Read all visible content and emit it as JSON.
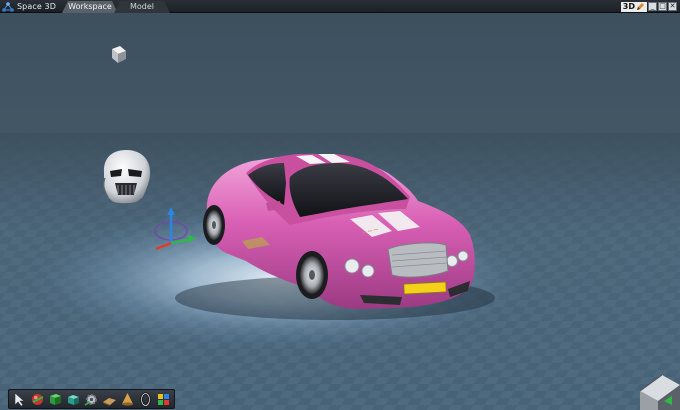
{
  "app": {
    "title": "Space 3D",
    "logo_icon": "molecule-icon"
  },
  "tabs": [
    {
      "label": "Workspace",
      "active": true
    },
    {
      "label": "Model",
      "active": false
    }
  ],
  "window_controls": {
    "view_mode": "3D",
    "buttons": [
      "minimize-icon",
      "restore-icon",
      "close-icon"
    ],
    "glyphs": {
      "minimize": "_",
      "restore": "□",
      "close": "✕"
    }
  },
  "scene": {
    "objects": [
      "sports-car",
      "helmet",
      "cube",
      "axis-gizmo",
      "view-cube"
    ],
    "car_color": "#d85fb4",
    "floor_color": "#5a7d99",
    "sky_color": "#3f5463"
  },
  "toolbar": {
    "tools": [
      "select-arrow-icon",
      "sphere-icon",
      "cube-icon",
      "box-icon",
      "gear-icon",
      "plane-icon",
      "cone-icon",
      "torus-icon",
      "material-icon"
    ]
  }
}
